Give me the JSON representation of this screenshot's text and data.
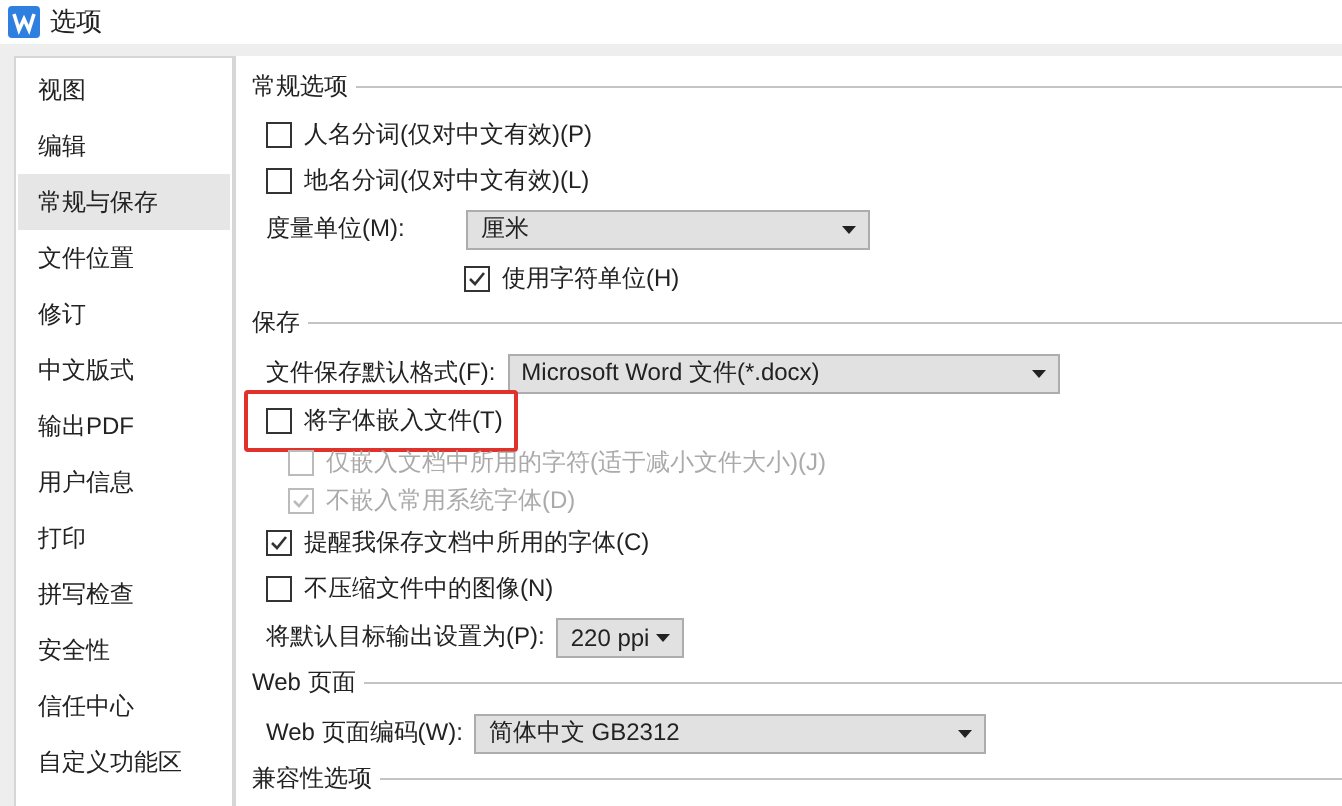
{
  "window": {
    "title": "选项"
  },
  "sidebar": {
    "items": [
      {
        "label": "视图",
        "selected": false
      },
      {
        "label": "编辑",
        "selected": false
      },
      {
        "label": "常规与保存",
        "selected": true
      },
      {
        "label": "文件位置",
        "selected": false
      },
      {
        "label": "修订",
        "selected": false
      },
      {
        "label": "中文版式",
        "selected": false
      },
      {
        "label": "输出PDF",
        "selected": false
      },
      {
        "label": "用户信息",
        "selected": false
      },
      {
        "label": "打印",
        "selected": false
      },
      {
        "label": "拼写检查",
        "selected": false
      },
      {
        "label": "安全性",
        "selected": false
      },
      {
        "label": "信任中心",
        "selected": false
      },
      {
        "label": "自定义功能区",
        "selected": false
      }
    ]
  },
  "sections": [
    {
      "title": "常规选项",
      "rows": [
        {
          "kind": "checkbox",
          "label": "人名分词(仅对中文有效)(P)",
          "checked": false,
          "disabled": false
        },
        {
          "kind": "checkbox",
          "label": "地名分词(仅对中文有效)(L)",
          "checked": false,
          "disabled": false
        },
        {
          "kind": "select",
          "label": "度量单位(M):",
          "value": "厘米"
        },
        {
          "kind": "inset-checkbox",
          "label": "使用字符单位(H)",
          "checked": true,
          "disabled": false
        }
      ]
    },
    {
      "title": "保存",
      "rows": [
        {
          "kind": "select",
          "label": "文件保存默认格式(F):",
          "value": "Microsoft Word 文件(*.docx)"
        },
        {
          "kind": "checkbox",
          "label": "将字体嵌入文件(T)",
          "checked": false,
          "disabled": false,
          "highlighted": true,
          "children": [
            {
              "kind": "checkbox",
              "label": "仅嵌入文档中所用的字符(适于减小文件大小)(J)",
              "checked": false,
              "disabled": true
            },
            {
              "kind": "checkbox",
              "label": "不嵌入常用系统字体(D)",
              "checked": true,
              "disabled": true
            }
          ]
        },
        {
          "kind": "checkbox",
          "label": "提醒我保存文档中所用的字体(C)",
          "checked": true,
          "disabled": false
        },
        {
          "kind": "checkbox",
          "label": "不压缩文件中的图像(N)",
          "checked": false,
          "disabled": false
        },
        {
          "kind": "select",
          "label": "将默认目标输出设置为(P):",
          "value": "220 ppi"
        }
      ]
    },
    {
      "title": "Web 页面",
      "rows": [
        {
          "kind": "select",
          "label": "Web 页面编码(W):",
          "value": "简体中文 GB2312"
        }
      ]
    },
    {
      "title": "兼容性选项"
    }
  ]
}
